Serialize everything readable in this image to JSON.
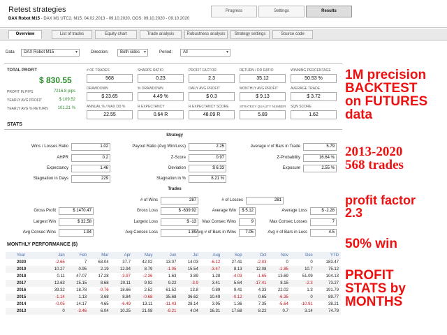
{
  "header": {
    "title": "Retest strategies",
    "subtitle_bold": "DAX Robot M15",
    "subtitle_rest": " - DAX  M1  UTC2, M15, 04.02.2013 - 09.10.2020, OOS: 09.10.2020 - 09.10.2020",
    "tabs": [
      "Progress",
      "Settings",
      "Results"
    ],
    "active_tab": "Results"
  },
  "subtabs": {
    "items": [
      "Overview",
      "List of trades",
      "Equity chart",
      "Trade analysis",
      "Robustness analysis",
      "Strategy settings",
      "Source code"
    ],
    "active": "Overview"
  },
  "filters": {
    "data_label": "Data",
    "data_value": "DAX Robot M15",
    "direction_label": "Direction:",
    "direction_value": "Both sides",
    "period_label": "Period:",
    "period_value": "All"
  },
  "summary": {
    "total_profit_label": "TOTAL PROFIT",
    "total_profit": "$ 830.55",
    "rows": [
      {
        "label": "PROFIT IN PIPS",
        "value": "7216.8 pips"
      },
      {
        "label": "YEARLY AVG PROFIT",
        "value": "$ 109.52"
      },
      {
        "label": "YEARLY AVG % RETURN",
        "value": "101.21 %"
      }
    ]
  },
  "metrics": [
    {
      "label": "# OF TRADES",
      "value": "568"
    },
    {
      "label": "SHARPE RATIO",
      "value": "0.23"
    },
    {
      "label": "PROFIT FACTOR",
      "value": "2.3"
    },
    {
      "label": "RETURN / DD RATIO",
      "value": "35.12"
    },
    {
      "label": "WINNING PERCENTAGE",
      "value": "50.53 %"
    },
    {
      "label": "DRAWDOWN",
      "value": "$ 23.65"
    },
    {
      "label": "% DRAWDOWN",
      "value": "4.49 %"
    },
    {
      "label": "DAILY AVG PROFIT",
      "value": "$ 0.3"
    },
    {
      "label": "MONTHLY AVG PROFIT",
      "value": "$ 9.13"
    },
    {
      "label": "AVERAGE TRADE",
      "value": "$ 3.72"
    },
    {
      "label": "ANNUAL % / Max DD %",
      "value": "22.55"
    },
    {
      "label": "R EXPECTANCY",
      "value": "0.64 R"
    },
    {
      "label": "R EXPECTANCY SCORE",
      "value": "48.09 R"
    },
    {
      "label": "STRATEGY QUALITY NUMBER",
      "value": "5.89"
    },
    {
      "label": "SQN SCORE",
      "value": "1.62"
    }
  ],
  "stats": {
    "title": "STATS",
    "strategy_title": "Strategy",
    "strategy_rows": [
      [
        {
          "label": "Wins / Losses Ratio",
          "value": "1.02"
        },
        {
          "label": "Payout Ratio (Avg Win/Loss)",
          "value": "2.25"
        },
        {
          "label": "Average # of Bars in Trade",
          "value": "5.79"
        }
      ],
      [
        {
          "label": "AHPR",
          "value": "0.2"
        },
        {
          "label": "Z-Score",
          "value": "0.97"
        },
        {
          "label": "Z-Probability",
          "value": "16.64 %"
        }
      ],
      [
        {
          "label": "Expectancy",
          "value": "1.46"
        },
        {
          "label": "Deviation",
          "value": "$ 6.33"
        },
        {
          "label": "Exposure",
          "value": "2.55 %"
        }
      ],
      [
        {
          "label": "Stagnation in Days",
          "value": "229"
        },
        {
          "label": "Stagnation in %",
          "value": "8.21 %"
        }
      ]
    ],
    "trades_title": "Trades",
    "num_wins_label": "# of Wins",
    "num_wins": "287",
    "num_losses_label": "# of Losses",
    "num_losses": "281",
    "trade_rows": [
      [
        {
          "label": "Gross Profit",
          "value": "$ 1470.47"
        },
        {
          "label": "Gross Loss",
          "value": "$ -639.92"
        },
        {
          "label": "Average Win",
          "value": "$ 5.12"
        },
        {
          "label": "Average Loss",
          "value": "$ -2.28"
        }
      ],
      [
        {
          "label": "Largest Win",
          "value": "$ 32.58"
        },
        {
          "label": "Largest Loss",
          "value": "$ -13"
        },
        {
          "label": "Max Consec Wins",
          "value": "9"
        },
        {
          "label": "Max Consec Losses",
          "value": "7"
        }
      ],
      [
        {
          "label": "Avg Consec Wins",
          "value": "1.94"
        },
        {
          "label": "Avg Consec Loss",
          "value": "1.89"
        },
        {
          "label": "Avg # of Bars in Wins",
          "value": "7.05"
        },
        {
          "label": "Avg # of Bars in Loss",
          "value": "4.5"
        }
      ]
    ]
  },
  "monthly": {
    "title": "MONTHLY PERFORMANCE ($)",
    "columns": [
      "Year",
      "Jan",
      "Feb",
      "Mar",
      "Apr",
      "May",
      "Jun",
      "Jul",
      "Aug",
      "Sep",
      "Oct",
      "Nov",
      "Dec",
      "YTD"
    ],
    "rows": [
      [
        "2020",
        "-2.65",
        "7",
        "63.04",
        "37.7",
        "42.02",
        "13.07",
        "14.03",
        "-6.12",
        "27.41",
        "-2.03",
        "0",
        "0",
        "183.47"
      ],
      [
        "2019",
        "10.27",
        "0.95",
        "2.19",
        "12.94",
        "8.79",
        "-1.05",
        "15.54",
        "-3.47",
        "8.13",
        "12.08",
        "-1.85",
        "10.7",
        "75.12"
      ],
      [
        "2018",
        "0.11",
        "47.07",
        "17.28",
        "-3.97",
        "-2.36",
        "1.63",
        "3.89",
        "1.28",
        "-4.03",
        "-1.65",
        "13.69",
        "51.09",
        "104.13"
      ],
      [
        "2017",
        "12.63",
        "15.15",
        "8.68",
        "20.11",
        "9.92",
        "9.22",
        "-3.9",
        "3.41",
        "5.64",
        "-17.41",
        "8.15",
        "-2.3",
        "73.27"
      ],
      [
        "2016",
        "39.32",
        "18.78",
        "-0.76",
        "18.66",
        "2.52",
        "61.52",
        "13.8",
        "0.89",
        "9.41",
        "4.33",
        "22.02",
        "1.3",
        "191.79"
      ],
      [
        "2015",
        "-1.14",
        "1.13",
        "3.68",
        "8.84",
        "-0.68",
        "35.68",
        "36.62",
        "10.49",
        "-0.12",
        "0.65",
        "-6.35",
        "0",
        "89.77"
      ],
      [
        "2014",
        "-0.05",
        "14.17",
        "4.65",
        "-6.49",
        "13.11",
        "-11.43",
        "28.14",
        "3.95",
        "1.36",
        "7.35",
        "-5.64",
        "-10.91",
        "38.21"
      ],
      [
        "2013",
        "0",
        "-3.46",
        "6.04",
        "10.25",
        "21.08",
        "-9.21",
        "4.04",
        "16.31",
        "17.68",
        "8.22",
        "0.7",
        "3.14",
        "74.79"
      ]
    ]
  },
  "annotations": {
    "block1": [
      "1M precision",
      "BACKTEST",
      "on FUTURES",
      "data"
    ],
    "block2": [
      "2013-2020",
      "568 trades"
    ],
    "block3": [
      "profit factor",
      "2.3"
    ],
    "block4": [
      "50% win"
    ],
    "block5": [
      "PROFIT",
      "STATS by",
      "MONTHS"
    ]
  },
  "colors": {
    "profit_green": "#2c8a2c",
    "negative_red": "#c0141c",
    "annotation_red": "#ee1111",
    "header_blue": "#4a6fa5"
  }
}
